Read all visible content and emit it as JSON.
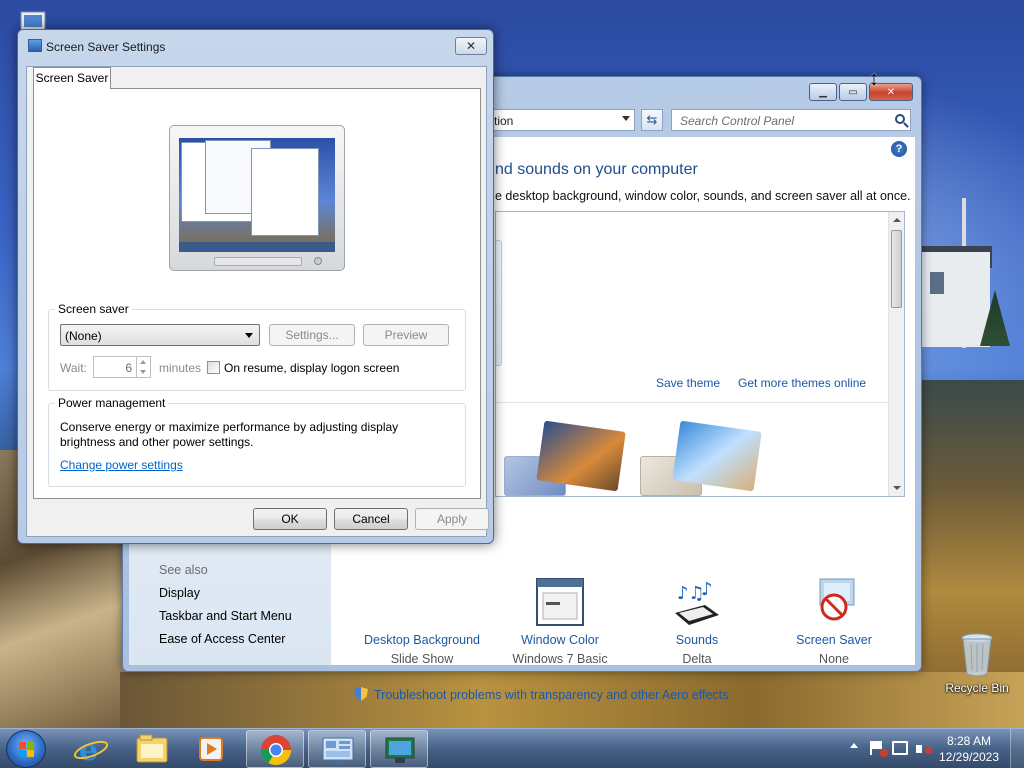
{
  "desktop": {
    "recycle_bin_label": "Recycle Bin"
  },
  "control_panel": {
    "address_text": "tion",
    "search_placeholder": "Search Control Panel",
    "heading": "nd sounds on your computer",
    "description": "e desktop background, window color, sounds, and screen saver all at once.",
    "theme_links": {
      "save_theme": "Save theme",
      "get_more_themes": "Get more themes online"
    },
    "items": [
      {
        "label": "Desktop Background",
        "sub": "Slide Show",
        "icon": "landscape-photos-icon"
      },
      {
        "label": "Window Color",
        "sub": "Windows 7 Basic",
        "icon": "window-color-icon"
      },
      {
        "label": "Sounds",
        "sub": "Delta",
        "icon": "sounds-icon"
      },
      {
        "label": "Screen Saver",
        "sub": "None",
        "icon": "screen-saver-icon"
      }
    ],
    "see_also": {
      "heading": "See also",
      "links": [
        "Display",
        "Taskbar and Start Menu",
        "Ease of Access Center"
      ]
    },
    "troubleshoot_link": "Troubleshoot problems with transparency and other Aero effects"
  },
  "dialog": {
    "title": "Screen Saver Settings",
    "tab": "Screen Saver",
    "screen_saver_group": {
      "label": "Screen saver",
      "selected": "(None)",
      "settings_button": "Settings...",
      "preview_button": "Preview",
      "wait_label": "Wait:",
      "wait_value": "6",
      "minutes_label": "minutes",
      "resume_checkbox_label": "On resume, display logon screen",
      "resume_checked": false
    },
    "power_group": {
      "label": "Power management",
      "text": "Conserve energy or maximize performance by adjusting display brightness and other power settings.",
      "link": "Change power settings"
    },
    "buttons": {
      "ok": "OK",
      "cancel": "Cancel",
      "apply": "Apply"
    }
  },
  "taskbar": {
    "clock_time": "8:28 AM",
    "clock_date": "12/29/2023",
    "apps": [
      "internet-explorer-icon",
      "file-explorer-icon",
      "media-player-icon",
      "chrome-icon",
      "control-panel-icon",
      "screen-saver-settings-icon"
    ]
  },
  "colors": {
    "link_blue": "#1c57a6",
    "title_blue": "#1e4d8f",
    "close_red": "#c7422b"
  }
}
